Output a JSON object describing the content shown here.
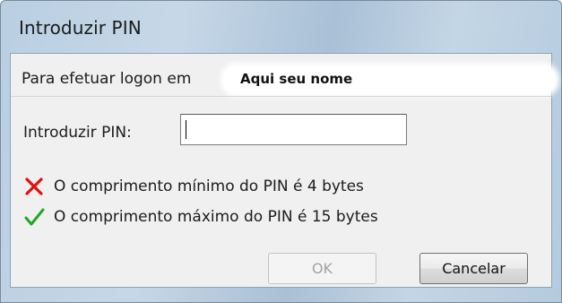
{
  "window": {
    "title": "Introduzir PIN"
  },
  "logon": {
    "prefix": "Para efetuar logon em",
    "user_name": "Aqui seu nome"
  },
  "pin": {
    "label": "Introduzir PIN:",
    "value": ""
  },
  "rules": [
    {
      "icon": "red-x-icon",
      "status": "fail",
      "color": "#e01010",
      "text": "O comprimento mínimo do PIN é 4 bytes"
    },
    {
      "icon": "green-check-icon",
      "status": "pass",
      "color": "#22a822",
      "text": "O comprimento máximo do PIN é 15 bytes"
    }
  ],
  "buttons": {
    "ok_label": "OK",
    "ok_enabled": false,
    "cancel_label": "Cancelar"
  }
}
